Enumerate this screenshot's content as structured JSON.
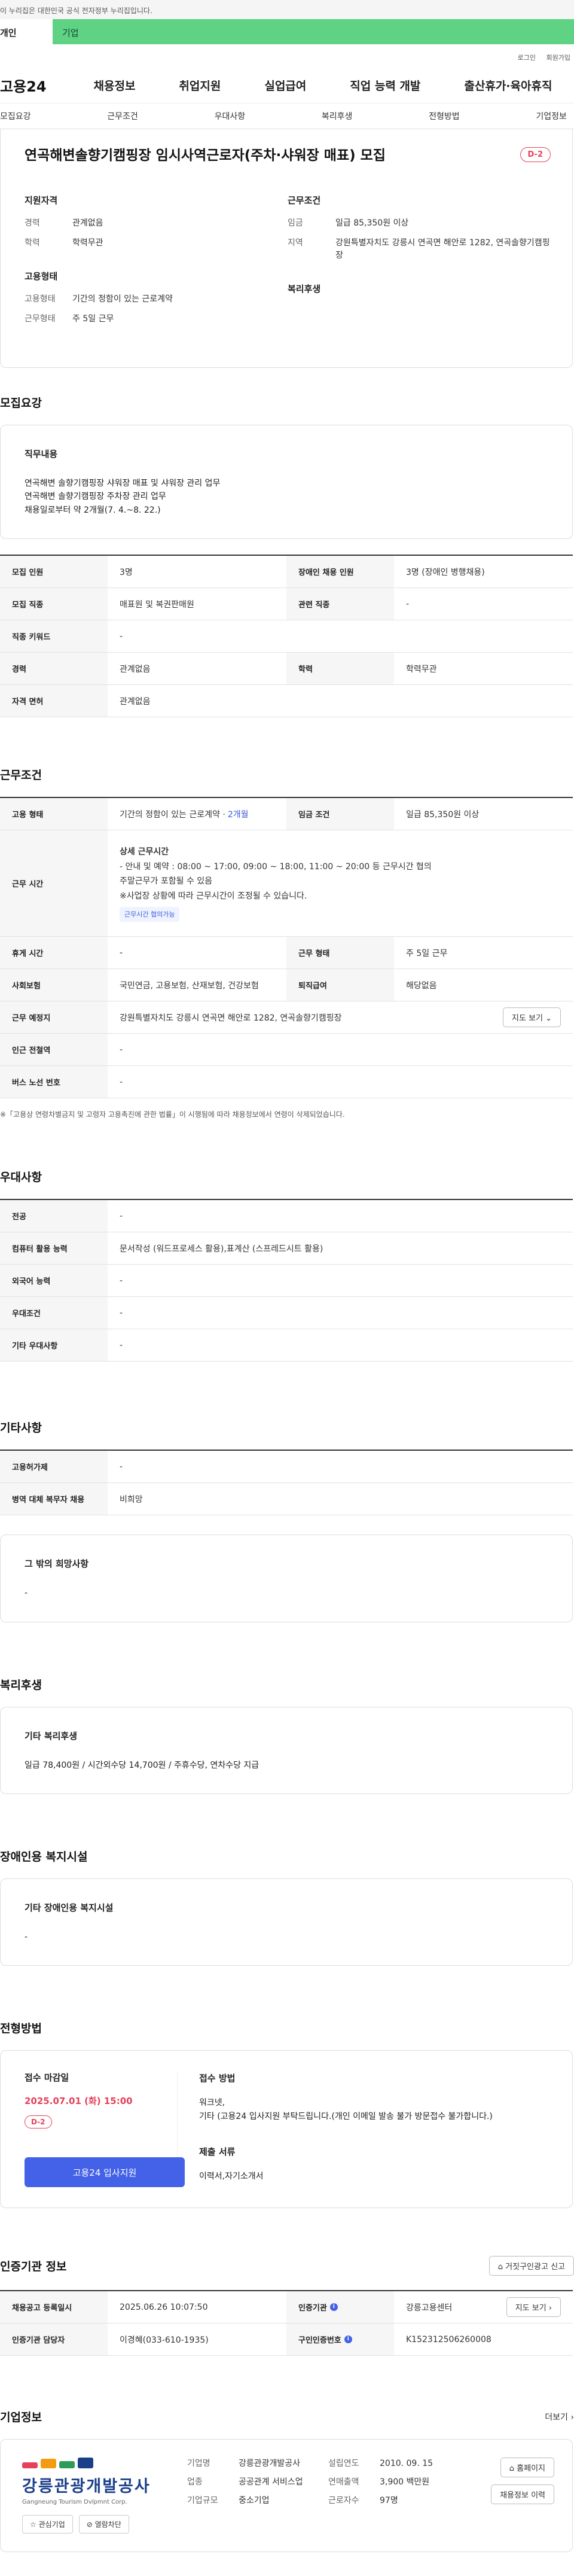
{
  "gov_banner": "이 누리집은 대한민국 공식 전자정부 누리집입니다.",
  "user_tabs": {
    "personal": "개인",
    "company": "기업"
  },
  "util": {
    "login": "로그인",
    "join": "회원가입"
  },
  "logo": "고용24",
  "gnb": [
    "채용정보",
    "취업지원",
    "실업급여",
    "직업 능력 개발",
    "출산휴가·육아휴직"
  ],
  "subnav": [
    "모집요강",
    "근무조건",
    "우대사항",
    "복리후생",
    "전형방법",
    "기업정보"
  ],
  "job": {
    "title": "연곡해변솔향기캠핑장 임시사역근로자(주차·샤워장 매표) 모집",
    "dday": "D-2",
    "qual_title": "지원자격",
    "cond_title": "근무조건",
    "emp_title": "고용형태",
    "welfare_title": "복리후생",
    "qual": [
      {
        "k": "경력",
        "v": "관계없음"
      },
      {
        "k": "학력",
        "v": "학력무관"
      }
    ],
    "cond": [
      {
        "k": "임금",
        "v": "일급 85,350원 이상"
      },
      {
        "k": "지역",
        "v": "강원특별자치도 강릉시 연곡면 해안로 1282, 연곡솔향기캠핑장"
      }
    ],
    "emp": [
      {
        "k": "고용형태",
        "v": "기간의 정함이 있는 근로계약"
      },
      {
        "k": "근무형태",
        "v": "주 5일 근무"
      }
    ]
  },
  "recruit": {
    "title": "모집요강",
    "duty_title": "직무내용",
    "duty_lines": [
      "연곡해변 솔향기캠핑장  샤워장 매표 및 샤워장 관리 업무",
      "연곡해변 솔향기캠핑장 주차장 관리 업무",
      "채용일로부터 약 2개월(7. 4.~8. 22.)"
    ],
    "rows": [
      {
        "th": "모집 인원",
        "td": "3명",
        "th2": "장애인 채용 인원",
        "td2": "3명 (장애인 병행채용)"
      },
      {
        "th": "모집 직종",
        "td": "매표원 및 복권판매원",
        "th2": "관련 직종",
        "td2": "-"
      }
    ],
    "rows_full": [
      {
        "th": "직종 키워드",
        "td": "-"
      }
    ],
    "rows2": [
      {
        "th": "경력",
        "td": "관계없음",
        "th2": "학력",
        "td2": "학력무관"
      }
    ],
    "rows_full2": [
      {
        "th": "자격 면허",
        "td": "관계없음"
      }
    ]
  },
  "work": {
    "title": "근무조건",
    "emp_type_th": "고용 형태",
    "emp_type_td": "기간의 정함이 있는 근로계약 · ",
    "emp_period": "2개월",
    "wage_th": "임금 조건",
    "wage_td": "일급 85,350원 이상",
    "time_th": "근무 시간",
    "time_title": "상세 근무시간",
    "time_lines": [
      "- 안내 및 예약 : 08:00 ~ 17:00, 09:00 ~ 18:00, 11:00 ~ 20:00 등 근무시간 협의",
      "주말근무가 포함될 수 있음",
      "※사업장 상황에 따라 근무시간이 조정될 수 있습니다."
    ],
    "time_tag": "근무시간 협의가능",
    "rest_th": "휴게 시간",
    "rest_td": "-",
    "form_th": "근무 형태",
    "form_td": "주 5일 근무",
    "ins_th": "사회보험",
    "ins_td": "국민연금, 고용보험, 산재보험, 건강보험",
    "ret_th": "퇴직급여",
    "ret_td": "해당없음",
    "place_th": "근무 예정지",
    "place_td": "강원특별자치도 강릉시 연곡면 해안로 1282, 연곡솔향기캠핑장",
    "map_btn": "지도 보기 ⌄",
    "sub_th": "인근 전철역",
    "sub_td": "-",
    "bus_th": "버스 노선 번호",
    "bus_td": "-",
    "note": "※「고용상 연령차별금지 및 고령자 고용촉진에 관한 법률」이 시행됨에 따라 채용정보에서 연령이 삭제되었습니다."
  },
  "pref": {
    "title": "우대사항",
    "rows": [
      {
        "th": "전공",
        "td": "-"
      },
      {
        "th": "컴퓨터 활용 능력",
        "td": "문서작성 (워드프로세스 활용),표계산 (스프레드시트 활용)"
      },
      {
        "th": "외국어 능력",
        "td": "-"
      },
      {
        "th": "우대조건",
        "td": "-"
      },
      {
        "th": "기타 우대사항",
        "td": "-"
      }
    ]
  },
  "etc": {
    "title": "기타사항",
    "rows": [
      {
        "th": "고용허가제",
        "td": "-"
      },
      {
        "th": "병역 대체 복무자 채용",
        "td": "비희망"
      }
    ],
    "hope_title": "그 밖의 희망사항",
    "hope_text": "-"
  },
  "welfare": {
    "title": "복리후생",
    "card_title": "기타 복리후생",
    "text": "일급 78,400원 / 시간외수당 14,700원 / 주휴수당, 연차수당 지급"
  },
  "disabled": {
    "title": "장애인용 복지시설",
    "card_title": "기타 장애인용 복지시설",
    "text": "-"
  },
  "apply": {
    "title": "전형방법",
    "deadline_title": "접수 마감일",
    "deadline": "2025.07.01 (화) 15:00",
    "dday": "D-2",
    "btn": "고용24 입사지원",
    "method_title": "접수 방법",
    "method_lines": [
      "워크넷,",
      "기타 (고용24 입사지원 부탁드립니다.(개인 이메일 발송 불가 방문접수 불가합니다.)"
    ],
    "docs_title": "제출 서류",
    "docs": "이력서,자기소개서"
  },
  "cert": {
    "title": "인증기관 정보",
    "report_btn": "⌂ 거짓구인광고 신고",
    "r1": {
      "th": "채용공고 등록일시",
      "td": "2025.06.26 10:07:50",
      "th2": "인증기관",
      "td2": "강릉고용센터",
      "btn": "지도 보기 ›"
    },
    "r2": {
      "th": "인증기관 담당자",
      "td": "이경혜(033-610-1935)",
      "th2": "구인인증번호",
      "td2": "K152312506260008"
    }
  },
  "company": {
    "title": "기업정보",
    "more": "더보기 ›",
    "logo_text": "강릉관광개발공사",
    "logo_sub": "Gangneung Tourism Dvlpmnt Corp.",
    "fav": "☆ 관심기업",
    "block": "⊘ 열람차단",
    "c1": [
      {
        "k": "기업명",
        "v": "강릉관광개발공사"
      },
      {
        "k": "업종",
        "v": "공공관계 서비스업"
      },
      {
        "k": "기업규모",
        "v": "중소기업"
      }
    ],
    "c2": [
      {
        "k": "설립연도",
        "v": "2010. 09. 15"
      },
      {
        "k": "연매출액",
        "v": "3,900 백만원"
      },
      {
        "k": "근로자수",
        "v": "97명"
      }
    ],
    "home_btn": "⌂ 홈페이지",
    "hist_btn": "채용정보 이력"
  }
}
